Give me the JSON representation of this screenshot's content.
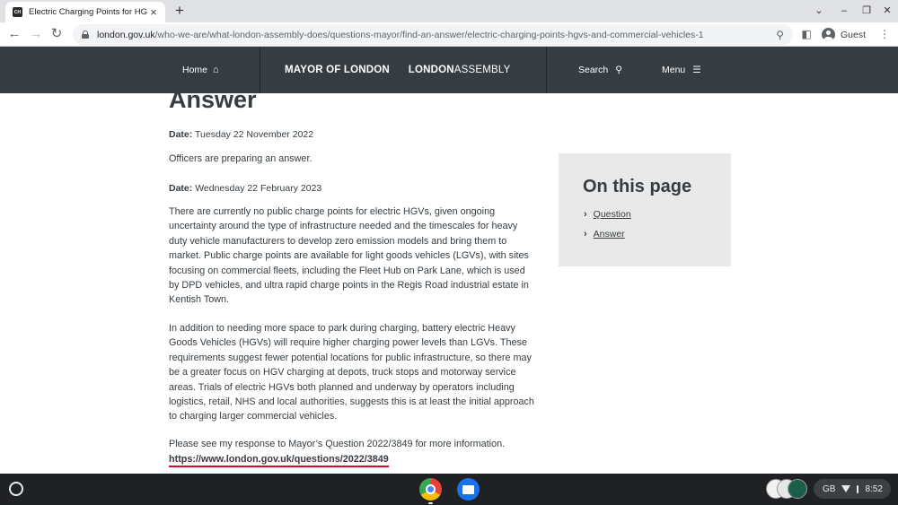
{
  "browser": {
    "tab_title": "Electric Charging Points for HGV",
    "tab_favicon_text": "CH",
    "url_host": "london.gov.uk",
    "url_path": "/who-we-are/what-london-assembly-does/questions-mayor/find-an-answer/electric-charging-points-hgvs-and-commercial-vehicles-1",
    "profile_label": "Guest"
  },
  "header": {
    "home_label": "Home",
    "brand_mayor": "MAYOR OF LONDON",
    "brand_london": "LONDON",
    "brand_assembly": "ASSEMBLY",
    "search_label": "Search",
    "menu_label": "Menu",
    "background_color": "#353d42"
  },
  "main": {
    "heading": "Answer",
    "date1_label": "Date:",
    "date1_value": "Tuesday 22 November 2022",
    "status_text": "Officers are preparing an answer.",
    "date2_label": "Date:",
    "date2_value": "Wednesday 22 February 2023",
    "paragraph1": "There are currently no public charge points for electric HGVs, given ongoing uncertainty around the type of infrastructure needed and the timescales for heavy duty vehicle manufacturers to develop zero emission models and bring them to market. Public charge points are available for light goods vehicles (LGVs), with sites focusing on commercial fleets, including the Fleet Hub on Park Lane, which is used by DPD vehicles, and ultra rapid charge points in the Regis Road industrial estate in Kentish Town.",
    "paragraph2": "In addition to needing more space to park during charging, battery electric Heavy Goods Vehicles (HGVs) will require higher charging power levels than LGVs. These requirements suggest fewer potential locations for public infrastructure, so there may be a greater focus on HGV charging at depots, truck stops and motorway service areas. Trials of electric HGVs both planned and underway by operators including logistics, retail, NHS and local authorities, suggests this is at least the initial approach to charging larger commercial vehicles.",
    "paragraph3": "Please see my response to Mayor’s Question 2022/3849 for more information.",
    "link_text": "https://www.london.gov.uk/questions/2022/3849",
    "link_underline_color": "#d0102b"
  },
  "sidebar": {
    "title": "On this page",
    "links": [
      {
        "label": "Question"
      },
      {
        "label": "Answer"
      }
    ]
  },
  "shelf": {
    "keyboard_layout": "GB",
    "time": "8:52"
  }
}
